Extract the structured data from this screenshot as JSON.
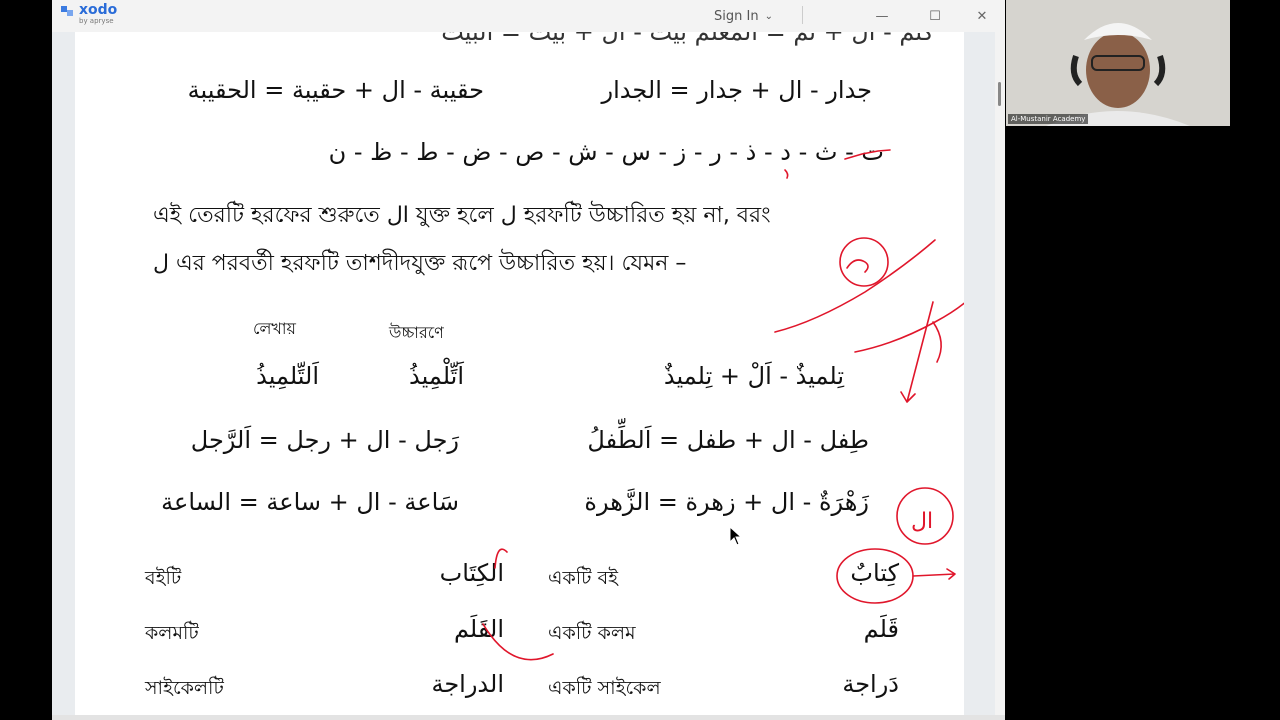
{
  "app": {
    "name": "xodo",
    "sub": "by apryse"
  },
  "titlebar": {
    "signin": "Sign In",
    "controls": {
      "minimize": "—",
      "maximize": "☐",
      "close": "✕"
    }
  },
  "doc": {
    "top_line": "كتم - ال + تم = المعلم   بيت - ال + بيت = البيت",
    "row1_left": "جدار - ال + جدار = الجدار",
    "row1_right": "حقيبة - ال + حقيبة = الحقيبة",
    "letters": "ت - ث - د - ذ - ر - ز - س - ش - ص - ض - ط - ظ - ن",
    "bn_para1": "এই তেরটি হরফের শুরুতে ال যুক্ত হলে ل হরফটি উচ্চারিত হয় না, বরং",
    "bn_para2": "ل এর পরবর্তী হরফটি তাশদীদযুক্ত রূপে উচ্চারিত হয়। যেমন –",
    "label_writing": "লেখায়",
    "label_pronunciation": "উচ্চারণে",
    "ex1_formula": "تِلميذٌ - اَلْ + تِلميذٌ",
    "ex1_pron": "اَتِّلْمِيذُ",
    "ex1_write": "اَلتِّلمِيذُ",
    "ex2_left": "طِفل - ال + طفل = اَلطِّفلُ",
    "ex2_right": "رَجل - ال + رجل = اَلرَّجل",
    "ex3_left": "زَهْرَةٌ - ال + زهرة = الزَّهرة",
    "ex3_right": "سَاعة - ال + ساعة = الساعة",
    "vocab": [
      {
        "ar_indef": "كِتابٌ",
        "bn_indef": "একটি বই",
        "ar_def": "الكِتَاب",
        "bn_def": "বইটি"
      },
      {
        "ar_indef": "قَلَم",
        "bn_indef": "একটি কলম",
        "ar_def": "القَلَم",
        "bn_def": "কলমটি"
      },
      {
        "ar_indef": "دَراجة",
        "bn_indef": "একটি সাইকেল",
        "ar_def": "الدراجة",
        "bn_def": "সাইকেলটি"
      }
    ],
    "annotation_text": "ال"
  },
  "webcam": {
    "label": "Al-Mustanir Academy"
  },
  "colors": {
    "annotation": "#e0162b",
    "brand": "#2a6cd8"
  }
}
